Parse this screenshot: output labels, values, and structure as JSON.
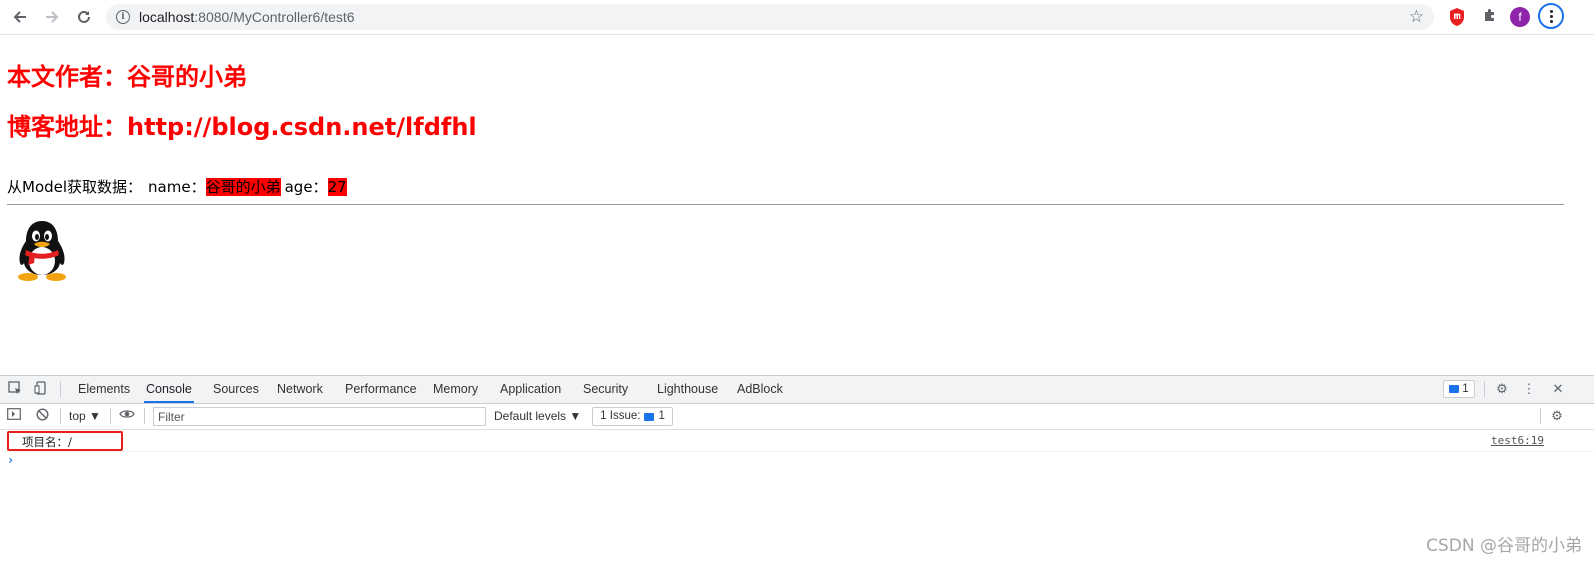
{
  "browser": {
    "url_host": "localhost",
    "url_rest": ":8080/MyController6/test6",
    "avatar_letter": "f"
  },
  "page": {
    "author_heading": "本文作者：谷哥的小弟",
    "blog_heading": "博客地址：http://blog.csdn.net/lfdfhl",
    "model_prefix": "从Model获取数据：",
    "name_label": "name：",
    "name_value": "谷哥的小弟",
    "age_label": "age：",
    "age_value": "27",
    "heading_color": "#ff0000"
  },
  "devtools": {
    "tabs": [
      "Elements",
      "Console",
      "Sources",
      "Network",
      "Performance",
      "Memory",
      "Application",
      "Security",
      "Lighthouse",
      "AdBlock"
    ],
    "active_tab": "Console",
    "issue_count": "1",
    "context": "top",
    "filter_placeholder": "Filter",
    "levels": "Default levels",
    "issues_label": "1 Issue:",
    "issues_count": "1",
    "log_message": "项目名：/",
    "log_source": "test6:19",
    "prompt": "›"
  },
  "watermark": "CSDN @谷哥的小弟"
}
